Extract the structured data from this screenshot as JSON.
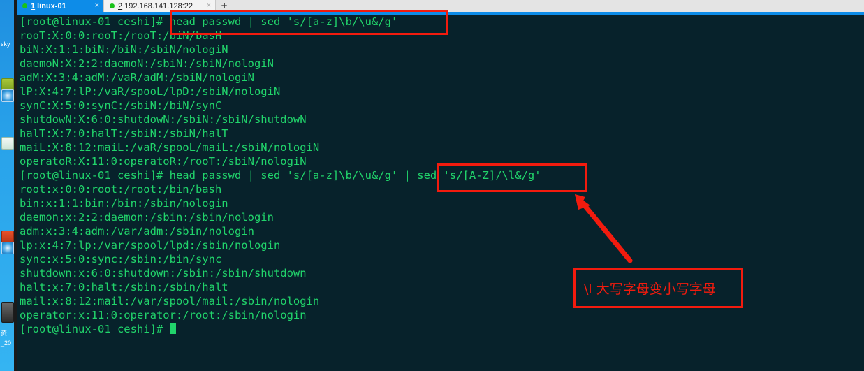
{
  "window": {
    "title": "linux-01 terminal"
  },
  "tabbar": {
    "tabs": [
      {
        "number": "1",
        "label": "linux-01",
        "status_icon": "green-dot",
        "close_icon": "×",
        "active": true
      },
      {
        "number": "2",
        "label": "192.168.141.128:22",
        "status_icon": "green-dot",
        "close_icon": "×",
        "active": false
      }
    ],
    "new_tab_label": "+",
    "active_color": "#0d8ce8",
    "dot_color": "#19c219"
  },
  "terminal": {
    "foreground": "#21d46b",
    "background": "#07222b",
    "prompt": "[root@linux-01 ceshi]#",
    "lines": [
      {
        "text": "[root@linux-01 ceshi]# head passwd | sed 's/[a-z]\\b/\\u&/g'"
      },
      {
        "text": "rooT:X:0:0:rooT:/rooT:/biN/basH"
      },
      {
        "text": "biN:X:1:1:biN:/biN:/sbiN/nologiN"
      },
      {
        "text": "daemoN:X:2:2:daemoN:/sbiN:/sbiN/nologiN"
      },
      {
        "text": "adM:X:3:4:adM:/vaR/adM:/sbiN/nologiN"
      },
      {
        "text": "lP:X:4:7:lP:/vaR/spooL/lpD:/sbiN/nologiN"
      },
      {
        "text": "synC:X:5:0:synC:/sbiN:/biN/synC"
      },
      {
        "text": "shutdowN:X:6:0:shutdowN:/sbiN:/sbiN/shutdowN"
      },
      {
        "text": "halT:X:7:0:halT:/sbiN:/sbiN/halT"
      },
      {
        "text": "maiL:X:8:12:maiL:/vaR/spooL/maiL:/sbiN/nologiN"
      },
      {
        "text": "operatoR:X:11:0:operatoR:/rooT:/sbiN/nologiN"
      },
      {
        "text": "[root@linux-01 ceshi]# head passwd | sed 's/[a-z]\\b/\\u&/g' | sed 's/[A-Z]/\\l&/g'"
      },
      {
        "text": "root:x:0:0:root:/root:/bin/bash"
      },
      {
        "text": "bin:x:1:1:bin:/bin:/sbin/nologin"
      },
      {
        "text": "daemon:x:2:2:daemon:/sbin:/sbin/nologin"
      },
      {
        "text": "adm:x:3:4:adm:/var/adm:/sbin/nologin"
      },
      {
        "text": "lp:x:4:7:lp:/var/spool/lpd:/sbin/nologin"
      },
      {
        "text": "sync:x:5:0:sync:/sbin:/bin/sync"
      },
      {
        "text": "shutdown:x:6:0:shutdown:/sbin:/sbin/shutdown"
      },
      {
        "text": "halt:x:7:0:halt:/sbin:/sbin/halt"
      },
      {
        "text": "mail:x:8:12:mail:/var/spool/mail:/sbin/nologin"
      },
      {
        "text": "operator:x:11:0:operator:/root:/sbin/nologin"
      }
    ],
    "last_prompt": "[root@linux-01 ceshi]# "
  },
  "annotations": {
    "highlight_color": "#f21b0e",
    "box1_target": "head passwd | sed 's/[a-z]\\b/\\u&/g'",
    "box2_target": "sed 's/[A-Z]/\\l&/g'",
    "note_text": "\\l 大写字母变小写字母"
  },
  "desktop": {
    "label_top": "sky",
    "label_mid": "资",
    "label_bottom": "_20"
  }
}
